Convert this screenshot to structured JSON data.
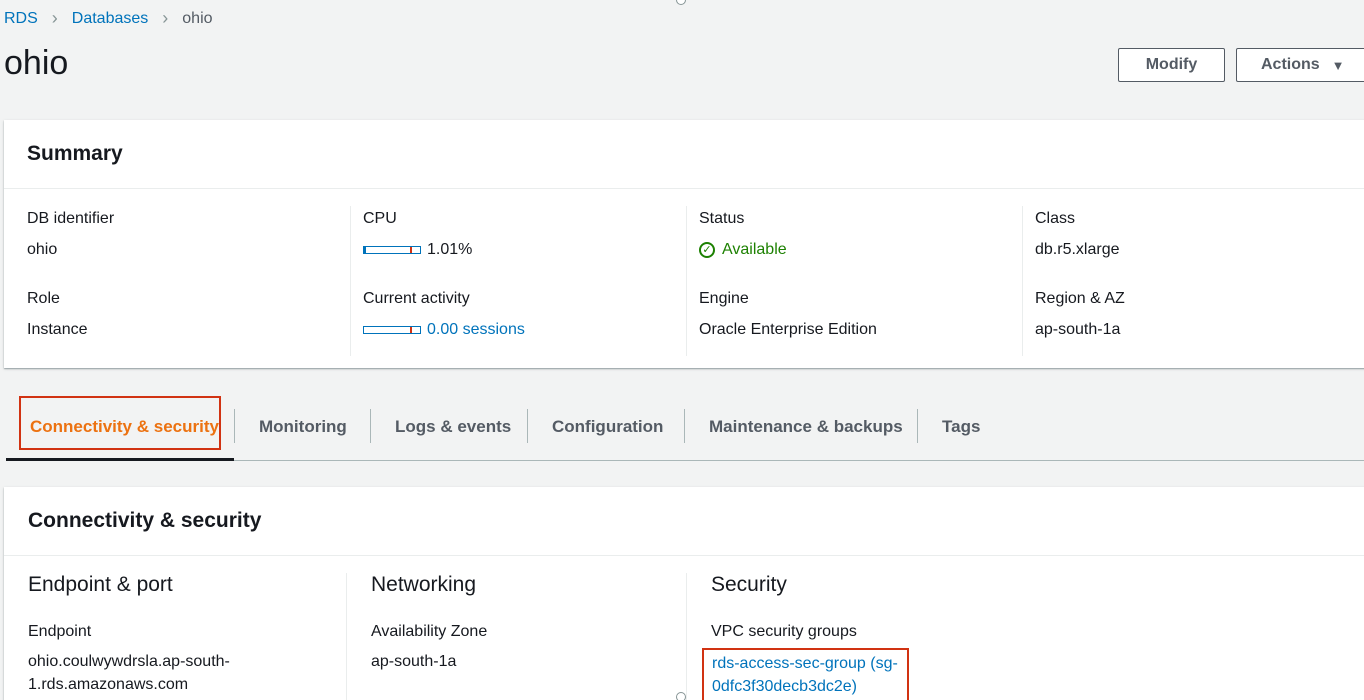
{
  "breadcrumb": {
    "items": [
      "RDS",
      "Databases"
    ],
    "current": "ohio"
  },
  "title": "ohio",
  "buttons": {
    "modify": "Modify",
    "actions": "Actions"
  },
  "summary": {
    "header": "Summary",
    "db_identifier": {
      "label": "DB identifier",
      "value": "ohio"
    },
    "role": {
      "label": "Role",
      "value": "Instance"
    },
    "cpu": {
      "label": "CPU",
      "value": "1.01%",
      "percent": 1.01
    },
    "current_activity": {
      "label": "Current activity",
      "value": "0.00 sessions"
    },
    "status": {
      "label": "Status",
      "value": "Available"
    },
    "engine": {
      "label": "Engine",
      "value": "Oracle Enterprise Edition"
    },
    "class": {
      "label": "Class",
      "value": "db.r5.xlarge"
    },
    "region": {
      "label": "Region & AZ",
      "value": "ap-south-1a"
    }
  },
  "tabs": [
    "Connectivity & security",
    "Monitoring",
    "Logs & events",
    "Configuration",
    "Maintenance & backups",
    "Tags"
  ],
  "connectivity": {
    "header": "Connectivity & security",
    "endpoint_port": {
      "title": "Endpoint & port",
      "endpoint_label": "Endpoint",
      "endpoint_line1": "ohio.coulwywdrsla.ap-south-",
      "endpoint_line2": "1.rds.amazonaws.com"
    },
    "networking": {
      "title": "Networking",
      "az_label": "Availability Zone",
      "az_value": "ap-south-1a"
    },
    "security": {
      "title": "Security",
      "vpc_label": "VPC security groups",
      "sg_line1": "rds-access-sec-group (sg-",
      "sg_line2": "0dfc3f30decb3dc2e)"
    }
  },
  "colors": {
    "link": "#0073bb",
    "success": "#1d8102",
    "active_tab": "#ec7211",
    "highlight_box": "#d13212"
  }
}
